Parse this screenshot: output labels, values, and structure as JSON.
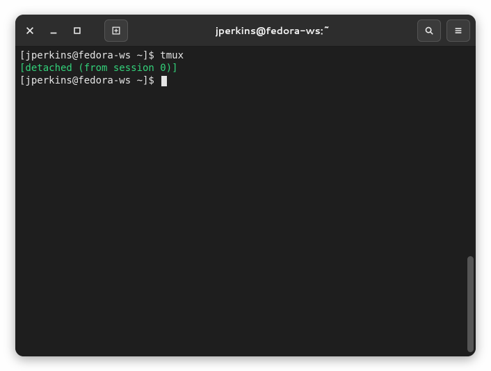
{
  "window": {
    "title": "jperkins@fedora-ws:~"
  },
  "titlebar": {
    "close_icon": "close",
    "minimize_icon": "minimize",
    "maximize_icon": "maximize",
    "newtab_icon": "new-tab",
    "search_icon": "search",
    "menu_icon": "hamburger"
  },
  "terminal": {
    "lines": [
      {
        "prompt": "[jperkins@fedora-ws ~]$ ",
        "command": "tmux"
      },
      {
        "text": "[detached (from session 0)]"
      },
      {
        "prompt": "[jperkins@fedora-ws ~]$ ",
        "command": "",
        "cursor": true
      }
    ]
  }
}
